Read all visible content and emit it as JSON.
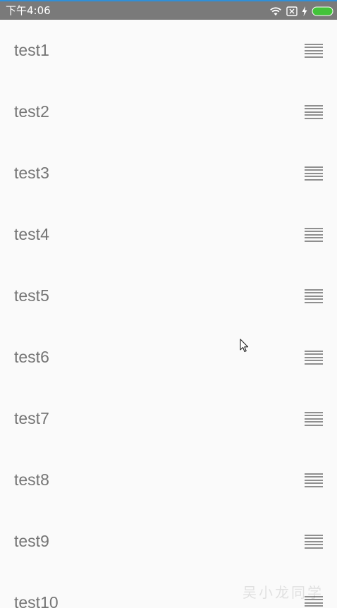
{
  "status_bar": {
    "time": "下午4:06",
    "icons": [
      "wifi-icon",
      "sim-x-icon",
      "charging-bolt-icon",
      "battery-icon"
    ],
    "battery_color": "#43c33a"
  },
  "list": {
    "items": [
      {
        "label": "test1"
      },
      {
        "label": "test2"
      },
      {
        "label": "test3"
      },
      {
        "label": "test4"
      },
      {
        "label": "test5"
      },
      {
        "label": "test6"
      },
      {
        "label": "test7"
      },
      {
        "label": "test8"
      },
      {
        "label": "test9"
      },
      {
        "label": "test10"
      }
    ],
    "handle_icon": "drag-handle-icon"
  },
  "watermark": "吴小龙同学"
}
